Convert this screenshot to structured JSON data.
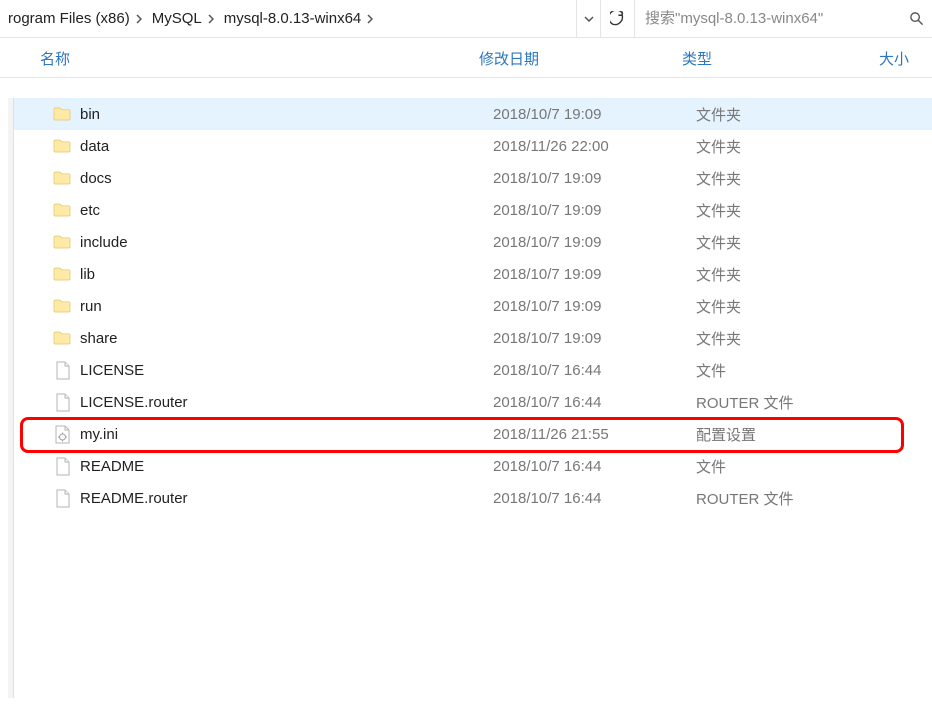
{
  "breadcrumb": [
    {
      "label": "rogram Files (x86)"
    },
    {
      "label": "MySQL"
    },
    {
      "label": "mysql-8.0.13-winx64"
    }
  ],
  "search": {
    "placeholder": "搜索\"mysql-8.0.13-winx64\""
  },
  "columns": {
    "name": "名称",
    "date": "修改日期",
    "type": "类型",
    "size": "大小"
  },
  "rows": [
    {
      "icon": "folder",
      "name": "bin",
      "date": "2018/10/7 19:09",
      "type": "文件夹",
      "selected": true
    },
    {
      "icon": "folder",
      "name": "data",
      "date": "2018/11/26 22:00",
      "type": "文件夹"
    },
    {
      "icon": "folder",
      "name": "docs",
      "date": "2018/10/7 19:09",
      "type": "文件夹"
    },
    {
      "icon": "folder",
      "name": "etc",
      "date": "2018/10/7 19:09",
      "type": "文件夹"
    },
    {
      "icon": "folder",
      "name": "include",
      "date": "2018/10/7 19:09",
      "type": "文件夹"
    },
    {
      "icon": "folder",
      "name": "lib",
      "date": "2018/10/7 19:09",
      "type": "文件夹"
    },
    {
      "icon": "folder",
      "name": "run",
      "date": "2018/10/7 19:09",
      "type": "文件夹"
    },
    {
      "icon": "folder",
      "name": "share",
      "date": "2018/10/7 19:09",
      "type": "文件夹"
    },
    {
      "icon": "file",
      "name": "LICENSE",
      "date": "2018/10/7 16:44",
      "type": "文件"
    },
    {
      "icon": "file",
      "name": "LICENSE.router",
      "date": "2018/10/7 16:44",
      "type": "ROUTER 文件"
    },
    {
      "icon": "ini",
      "name": "my.ini",
      "date": "2018/11/26 21:55",
      "type": "配置设置",
      "highlighted": true
    },
    {
      "icon": "file",
      "name": "README",
      "date": "2018/10/7 16:44",
      "type": "文件"
    },
    {
      "icon": "file",
      "name": "README.router",
      "date": "2018/10/7 16:44",
      "type": "ROUTER 文件"
    }
  ]
}
